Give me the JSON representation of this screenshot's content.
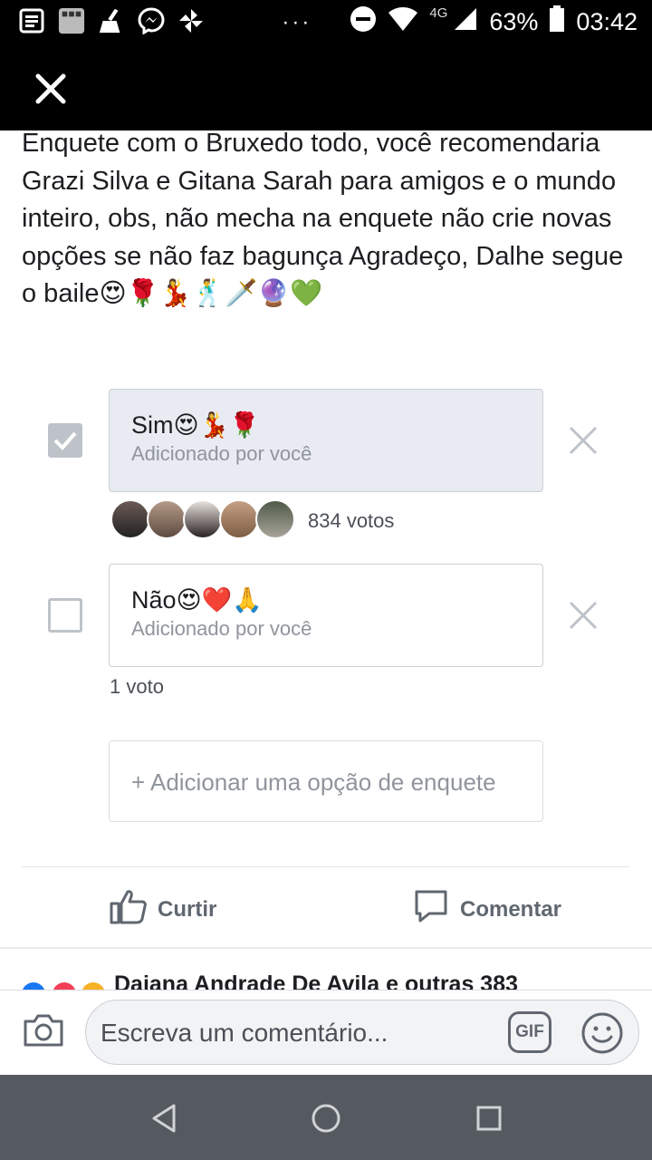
{
  "status_bar": {
    "network": "4G",
    "battery": "63%",
    "time": "03:42",
    "left_icons": [
      "news-icon",
      "gallery-icon",
      "cleaner-icon",
      "messenger-icon",
      "pinwheel-icon"
    ],
    "overflow": "···"
  },
  "header": {
    "close_icon": "close-icon"
  },
  "post": {
    "text": "Enquete com o Bruxedo todo, você recomendaria Grazi Silva e Gitana Sarah para amigos e o mundo inteiro, obs, não mecha na enquete não crie novas opções se não faz bagunça Agradeço, Dalhe segue o baile😍🌹💃🕺🗡️🔮💚"
  },
  "poll": {
    "options": [
      {
        "label": "Sim😍💃🌹",
        "added_by": "Adicionado por você",
        "votes": "834 votos",
        "checked": true
      },
      {
        "label": "Não😍❤️🙏",
        "added_by": "Adicionado por você",
        "votes": "1 voto",
        "checked": false
      }
    ],
    "add_option": "+ Adicionar uma opção de enquete"
  },
  "actions": {
    "like": "Curtir",
    "comment": "Comentar"
  },
  "reactions": {
    "text": "Daiana Andrade De Avila e outras 383"
  },
  "comment_bar": {
    "placeholder": "Escreva um comentário...",
    "gif": "GIF"
  },
  "colors": {
    "accent_gray": "#606770",
    "selected_bg": "#e9ebf2",
    "check_gray": "#bec3c9",
    "nav_bg": "#555a60"
  }
}
